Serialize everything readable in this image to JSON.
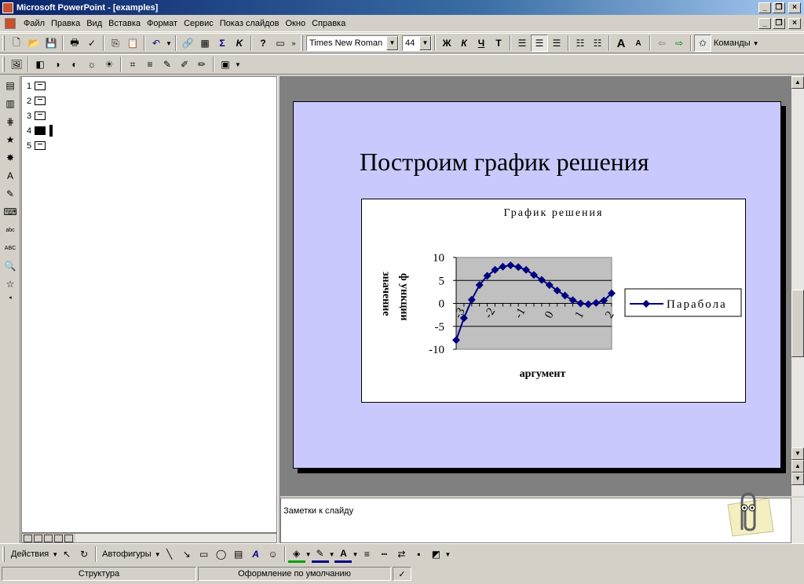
{
  "window": {
    "title": "Microsoft PowerPoint - [examples]"
  },
  "menu": {
    "items": [
      "Файл",
      "Правка",
      "Вид",
      "Вставка",
      "Формат",
      "Сервис",
      "Показ слайдов",
      "Окно",
      "Справка"
    ]
  },
  "toolbar": {
    "font_name": "Times New Roman",
    "font_size": "44",
    "bold_label": "Ж",
    "italic_label": "К",
    "underline_label": "Ч",
    "commands_label": "Команды"
  },
  "outline": {
    "slides": [
      {
        "number": "1"
      },
      {
        "number": "2"
      },
      {
        "number": "3"
      },
      {
        "number": "4"
      },
      {
        "number": "5"
      }
    ]
  },
  "slide": {
    "title": "Построим график решения"
  },
  "chart_data": {
    "type": "line",
    "title": "График решения",
    "xlabel": "аргумент",
    "ylabel_lines": [
      "значение",
      "ф ункции"
    ],
    "ylim": [
      -10,
      10
    ],
    "y_ticks": [
      "10",
      "5",
      "0",
      "-5",
      "-10"
    ],
    "x_tick_labels": [
      "-3",
      "-2",
      "-1",
      "0",
      "1",
      "2"
    ],
    "series": [
      {
        "name": "Парабола",
        "color": "#000080",
        "values": [
          -8,
          -3.2,
          0.8,
          4,
          6,
          7.3,
          8,
          8.3,
          7.9,
          7.3,
          6.2,
          5.1,
          4,
          2.8,
          1.7,
          0.7,
          0,
          -0.2,
          0.1,
          0.6,
          2.2
        ]
      }
    ],
    "legend_position": "right",
    "plot_background": "#c0c0c0"
  },
  "notes": {
    "placeholder": "Заметки к слайду"
  },
  "drawing": {
    "actions_label": "Действия",
    "autoshapes_label": "Автофигуры"
  },
  "status": {
    "view": "Структура",
    "design": "Оформление по умолчанию"
  }
}
